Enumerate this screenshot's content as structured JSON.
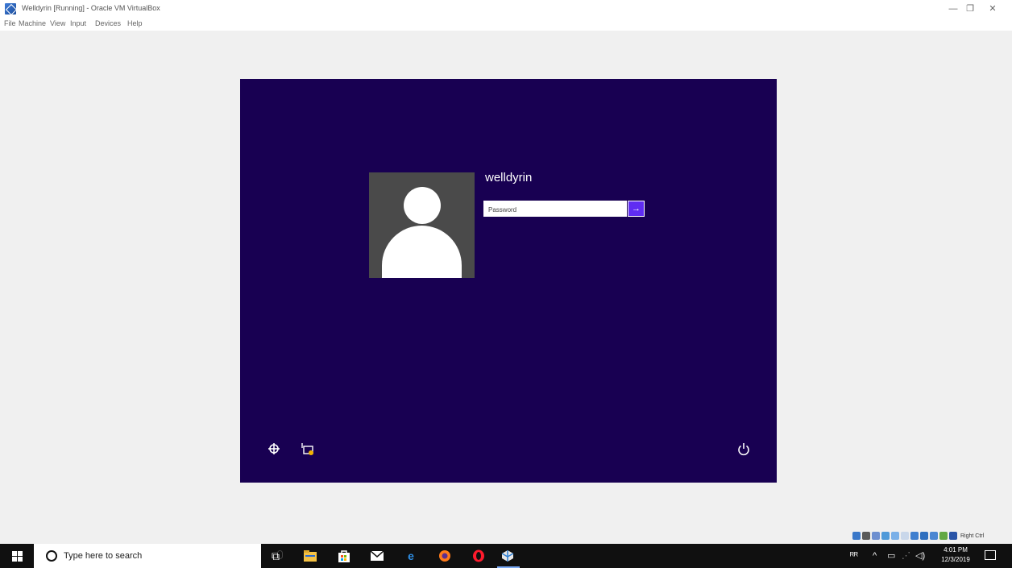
{
  "window": {
    "title": "Welldyrin [Running] - Oracle VM VirtualBox",
    "controls": {
      "minimize": "—",
      "maximize": "❐",
      "close": "✕"
    }
  },
  "menubar": {
    "items": [
      "File",
      "Machine",
      "View",
      "Input",
      "Devices",
      "Help"
    ]
  },
  "vm_screen": {
    "background": "#180052",
    "username": "welldyrin",
    "password_placeholder": "Password",
    "submit_arrow": "→",
    "ease_of_access_icon": "ease-of-access-icon",
    "network_icon": "network-icon",
    "power_icon": "power-icon"
  },
  "vbox_status": {
    "host_key": "Right Ctrl",
    "icons": [
      "storage-icon",
      "optical-icon",
      "audio-icon",
      "network-icon",
      "usb-icon",
      "shared-folder-icon",
      "display-icon",
      "recording-icon",
      "cpu-icon",
      "mouse-integration-icon",
      "keyboard-icon"
    ]
  },
  "taskbar": {
    "search_placeholder": "Type here to search",
    "apps": [
      "task-view-icon",
      "file-explorer-icon",
      "store-icon",
      "mail-icon",
      "edge-icon",
      "firefox-icon",
      "opera-icon",
      "virtualbox-icon"
    ],
    "time": "4:01 PM",
    "date": "12/3/2019"
  }
}
